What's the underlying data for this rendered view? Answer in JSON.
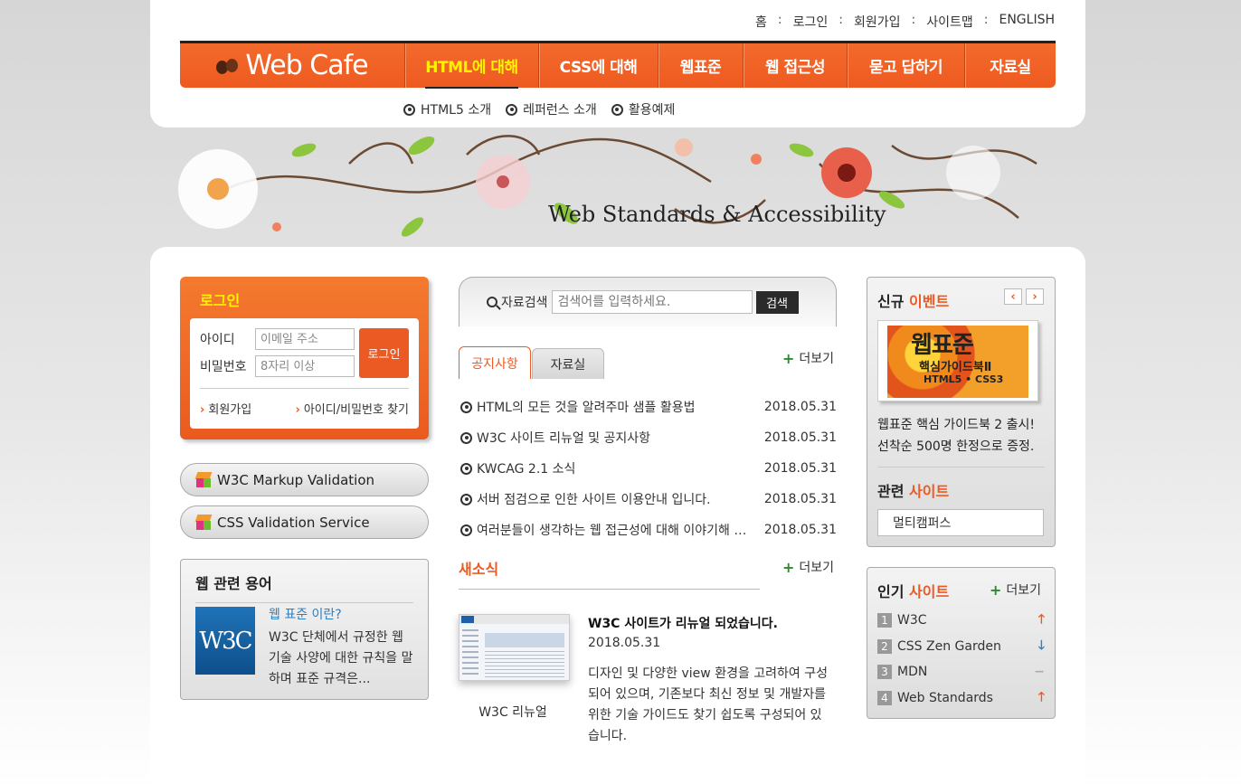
{
  "util_menu": [
    "홈",
    "로그인",
    "회원가입",
    "사이트맵",
    "ENGLISH"
  ],
  "logo": {
    "text": "Web Cafe"
  },
  "gnb": [
    {
      "label": "HTML에 대해",
      "active": true
    },
    {
      "label": "CSS에 대해",
      "active": false
    },
    {
      "label": "웹표준",
      "active": false
    },
    {
      "label": "웹 접근성",
      "active": false
    },
    {
      "label": "묻고 답하기",
      "active": false
    },
    {
      "label": "자료실",
      "active": false
    }
  ],
  "subnav": [
    "HTML5 소개",
    "레퍼런스 소개",
    "활용예제"
  ],
  "visual": {
    "caption": "Web Standards & Accessibility"
  },
  "login": {
    "title": "로그인",
    "id_label": "아이디",
    "id_placeholder": "이메일 주소",
    "pw_label": "비밀번호",
    "pw_placeholder": "8자리 이상",
    "button": "로그인",
    "join": "회원가입",
    "find": "아이디/비밀번호 찾기"
  },
  "validators": [
    "W3C Markup Validation",
    "CSS Validation Service"
  ],
  "term": {
    "title": "웹 관련 용어",
    "logo_text": "W3C",
    "question": "웹 표준 이란?",
    "desc": "W3C 단체에서 규정한 웹 기술 사양에 대한 규칙을 말하며 표준 규격은..."
  },
  "search": {
    "label": "자료검색",
    "placeholder": "검색어를 입력하세요.",
    "button": "검색"
  },
  "tabs": [
    {
      "label": "공지사항",
      "active": true
    },
    {
      "label": "자료실",
      "active": false
    }
  ],
  "more_label": "더보기",
  "notices": [
    {
      "title": "HTML의 모든 것을 알려주마 샘플 활용법",
      "date": "2018.05.31"
    },
    {
      "title": "W3C 사이트 리뉴얼 및 공지사항",
      "date": "2018.05.31"
    },
    {
      "title": "KWCAG 2.1 소식",
      "date": "2018.05.31"
    },
    {
      "title": "서버 점검으로 인한 사이트 이용안내 입니다.",
      "date": "2018.05.31"
    },
    {
      "title": "여러분들이 생각하는 웹 접근성에 대해 이야기해 봅시다",
      "date": "2018.05.31"
    }
  ],
  "news": {
    "section_title": "새소식",
    "thumb_caption": "W3C 리뉴얼",
    "headline": "W3C 사이트가 리뉴얼 되었습니다.",
    "date": "2018.05.31",
    "body": "디자인 및 다양한 view 환경을 고려하여 구성되어 있으며, 기존보다 최신 정보 및 개발자를 위한 기술 가이드도 찾기 쉽도록 구성되어 있습니다."
  },
  "event": {
    "title_a": "신규",
    "title_b": "이벤트",
    "prev": "‹",
    "next": "›",
    "book_title": "웹표준",
    "book_sub": "핵심가이드북Ⅱ",
    "book_tag": "HTML5 • CSS3",
    "caption": "웹표준 핵심 가이드북 2 출시! 선착순 500명 한정으로 증정."
  },
  "related": {
    "title_a": "관련",
    "title_b": "사이트",
    "selected": "멀티캠퍼스"
  },
  "popular": {
    "title_a": "인기",
    "title_b": "사이트",
    "items": [
      {
        "rank": "1",
        "name": "W3C",
        "trend": "up"
      },
      {
        "rank": "2",
        "name": "CSS Zen Garden",
        "trend": "down"
      },
      {
        "rank": "3",
        "name": "MDN",
        "trend": "same"
      },
      {
        "rank": "4",
        "name": "Web Standards",
        "trend": "up"
      }
    ]
  },
  "colors": {
    "accent": "#ec5a23",
    "highlight": "#fff200",
    "plus": "#2c8b2f"
  }
}
